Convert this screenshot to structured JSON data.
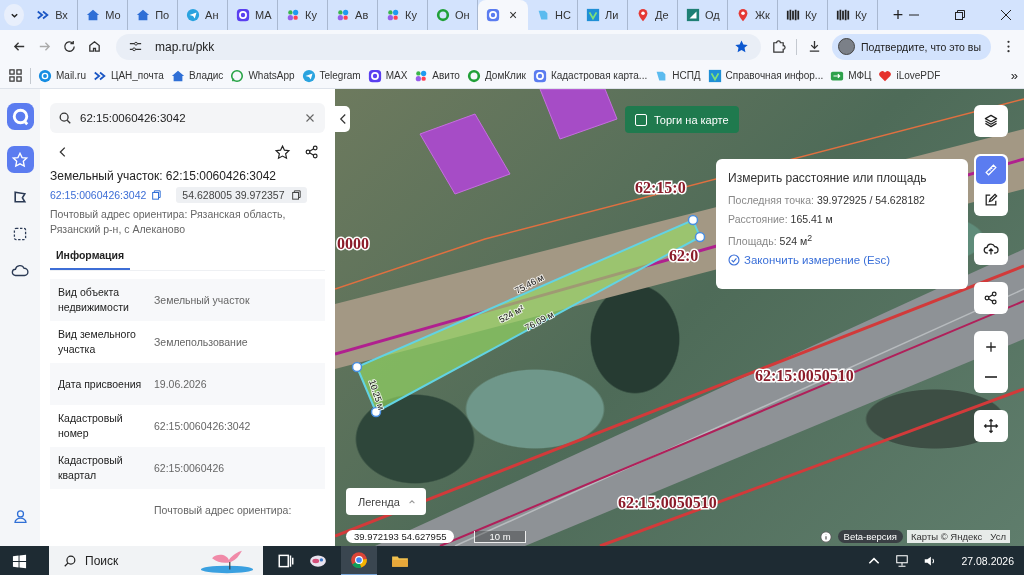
{
  "browser": {
    "tabs": [
      {
        "kind": "arrows",
        "label": "Вх",
        "selected": false
      },
      {
        "kind": "house",
        "label": "Мо",
        "selected": false
      },
      {
        "kind": "house",
        "label": "По",
        "selected": false
      },
      {
        "kind": "telegram",
        "label": "Ан",
        "selected": false
      },
      {
        "kind": "max",
        "label": "МА",
        "selected": false
      },
      {
        "kind": "avito",
        "label": "Ку",
        "selected": false
      },
      {
        "kind": "avito",
        "label": "Ав",
        "selected": false
      },
      {
        "kind": "avito",
        "label": "Ку",
        "selected": false
      },
      {
        "kind": "domclick",
        "label": "Он",
        "selected": false
      },
      {
        "kind": "kadastr",
        "close": "×",
        "selected": true
      },
      {
        "kind": "nspd",
        "label": "НС",
        "selected": false
      },
      {
        "kind": "ref",
        "label": "Ли",
        "selected": false
      },
      {
        "kind": "pin",
        "label": "Де",
        "selected": false
      },
      {
        "kind": "od",
        "label": "Од",
        "selected": false
      },
      {
        "kind": "pin",
        "label": "Жк",
        "selected": false
      },
      {
        "kind": "kug",
        "label": "Ку",
        "selected": false
      },
      {
        "kind": "kug",
        "label": "Ку",
        "selected": false
      }
    ],
    "new_tab": "+",
    "address": "map.ru/pkk",
    "profile_chip": "Подтвердите, что это вы",
    "bookmarks": [
      {
        "kind": "mail",
        "label": "Mail.ru"
      },
      {
        "kind": "arrows",
        "label": "ЦАН_почта"
      },
      {
        "kind": "house",
        "label": "Владис"
      },
      {
        "kind": "whatsapp",
        "label": "WhatsApp"
      },
      {
        "kind": "telegram",
        "label": "Telegram"
      },
      {
        "kind": "max",
        "label": "MAX"
      },
      {
        "kind": "avito",
        "label": "Авито"
      },
      {
        "kind": "domclick",
        "label": "ДомКлик"
      },
      {
        "kind": "kadastr",
        "label": "Кадастровая карта..."
      },
      {
        "kind": "nspd",
        "label": "НСПД"
      },
      {
        "kind": "ref",
        "label": "Справочная инфор..."
      },
      {
        "kind": "mfc",
        "label": "МФЦ"
      },
      {
        "kind": "pdf",
        "label": "iLovePDF"
      }
    ],
    "more": "»"
  },
  "rail": {
    "items": [
      {
        "kind": "star",
        "selected": true
      },
      {
        "kind": "polygon",
        "selected": false
      },
      {
        "kind": "dashed-square",
        "selected": false
      },
      {
        "kind": "cloud",
        "selected": false
      }
    ]
  },
  "panel": {
    "search": {
      "value": "62:15:0060426:3042"
    },
    "title": "Земельный участок: 62:15:0060426:3042",
    "cadastral_link": "62:15:0060426:3042",
    "coordinates": "54.628005 39.972357",
    "address": "Почтовый адрес ориентира: Рязанская область, Рязанский р-н, с Алеканово",
    "tabs": [
      {
        "label": "Информация",
        "selected": true
      }
    ],
    "rows": [
      {
        "label": "Вид объекта недвижимости",
        "value": "Земельный участок"
      },
      {
        "label": "Вид земельного участка",
        "value": "Землепользование"
      },
      {
        "label": "Дата присвоения",
        "value": "19.06.2026"
      },
      {
        "label": "Кадастровый номер",
        "value": "62:15:0060426:3042"
      },
      {
        "label": "Кадастровый квартал",
        "value": "62:15:0060426"
      },
      {
        "value": "Почтовый адрес ориентира:"
      }
    ]
  },
  "map": {
    "auctions": {
      "label": "Торги на карте",
      "checked": false
    },
    "measure": {
      "title": "Измерить расстояние или площадь",
      "last_point_label": "Последняя точка:",
      "last_point": "39.972925 / 54.628182",
      "distance_label": "Расстояние:",
      "distance": "165.41 м",
      "area_label": "Площадь:",
      "area": "524 м$^{2}$",
      "finish": "Закончить измерение (Esc)"
    },
    "tool_groups": [
      {
        "tools": [
          {
            "kind": "layers",
            "selected": false
          }
        ]
      },
      {
        "tools": [
          {
            "kind": "ruler",
            "selected": true
          },
          {
            "kind": "pencil",
            "selected": false
          }
        ]
      },
      {
        "tools": [
          {
            "kind": "cloud-upload",
            "selected": false
          }
        ]
      },
      {
        "tools": [
          {
            "kind": "share",
            "selected": false
          }
        ]
      },
      {
        "tools": [
          {
            "kind": "zoom-in",
            "selected": false
          },
          {
            "kind": "zoom-out",
            "selected": false
          }
        ]
      },
      {
        "tools": [
          {
            "kind": "move",
            "selected": false
          }
        ]
      }
    ],
    "cadastral_labels": [
      "0000",
      "62:15:0",
      "62:0",
      "62:15:0050510",
      "62:15:0050510"
    ],
    "measure_labels": [
      "75.46 м",
      "524 м²",
      "76.09 м",
      "10.25 м"
    ],
    "legend": "Легенда",
    "cursor_coordinates": "39.972193 54.627955",
    "scale": "10 m",
    "beta": "Beta-версия",
    "copyright": "Карты © Яндекс",
    "terms": "Усл"
  },
  "taskbar": {
    "search_placeholder": "Поиск",
    "date": "27.08.2026"
  }
}
